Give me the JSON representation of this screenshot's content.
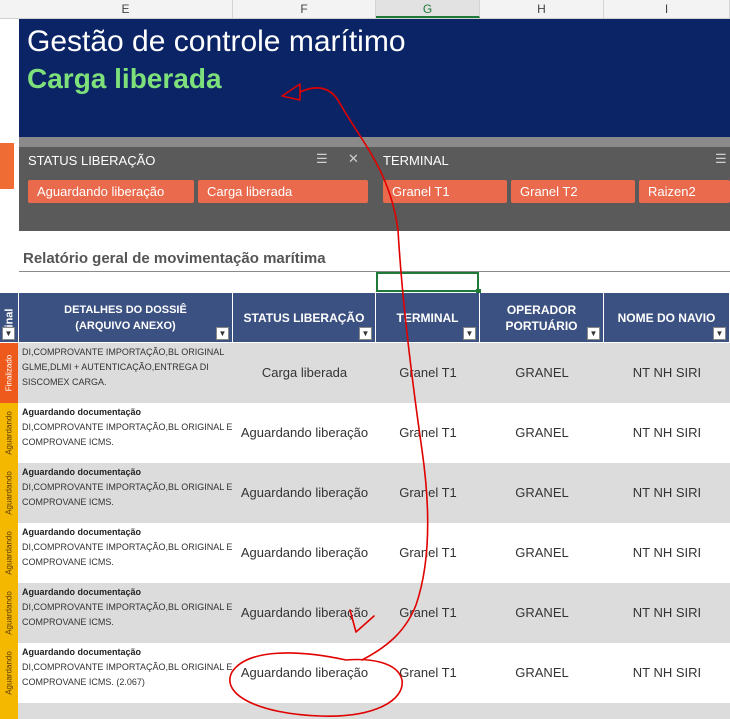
{
  "columns": [
    "E",
    "F",
    "G",
    "H",
    "I"
  ],
  "banner": {
    "title": "Gestão de controle marítimo",
    "subtitle": "Carga liberada"
  },
  "slicers": {
    "status": {
      "title": "STATUS LIBERAÇÃO",
      "items": [
        "Aguardando liberação",
        "Carga liberada"
      ]
    },
    "terminal": {
      "title": "TERMINAL",
      "items": [
        "Granel T1",
        "Granel T2",
        "Raizen2"
      ]
    }
  },
  "report_title": "Relatório geral de movimentação marítima",
  "table": {
    "headers": {
      "side": "inal",
      "details": "DETALHES DO DOSSIÊ (ARQUIVO ANEXO)",
      "status": "STATUS LIBERAÇÃO",
      "terminal": "TERMINAL",
      "operator": "OPERADOR PORTUÁRIO",
      "ship": "NOME DO NAVIO"
    },
    "rows": [
      {
        "tag": "Finalizado",
        "details_title": "",
        "details": "DI,COMPROVANTE IMPORTAÇÃO,BL ORIGINAL GLME,DLMI + AUTENTICAÇÃO,ENTREGA DI SISCOMEX CARGA.",
        "status": "Carga liberada",
        "terminal": "Granel T1",
        "operator": "GRANEL",
        "ship": "NT NH SIRI"
      },
      {
        "tag": "Aguardando",
        "details_title": "Aguardando documentação",
        "details": "DI,COMPROVANTE IMPORTAÇÃO,BL ORIGINAL E COMPROVANE ICMS.",
        "status": "Aguardando liberação",
        "terminal": "Granel T1",
        "operator": "GRANEL",
        "ship": "NT NH SIRI"
      },
      {
        "tag": "Aguardando",
        "details_title": "Aguardando documentação",
        "details": "DI,COMPROVANTE IMPORTAÇÃO,BL ORIGINAL E COMPROVANE ICMS.",
        "status": "Aguardando liberação",
        "terminal": "Granel T1",
        "operator": "GRANEL",
        "ship": "NT NH SIRI"
      },
      {
        "tag": "Aguardando",
        "details_title": "Aguardando documentação",
        "details": "DI,COMPROVANTE IMPORTAÇÃO,BL ORIGINAL E COMPROVANE ICMS.",
        "status": "Aguardando liberação",
        "terminal": "Granel T1",
        "operator": "GRANEL",
        "ship": "NT NH SIRI"
      },
      {
        "tag": "Aguardando",
        "details_title": "Aguardando documentação",
        "details": "DI,COMPROVANTE IMPORTAÇÃO,BL ORIGINAL E COMPROVANE ICMS.",
        "status": "Aguardando liberação",
        "terminal": "Granel T1",
        "operator": "GRANEL",
        "ship": "NT NH SIRI"
      },
      {
        "tag": "Aguardando",
        "details_title": "Aguardando documentação",
        "details": "DI,COMPROVANTE IMPORTAÇÃO,BL ORIGINAL E COMPROVANE ICMS. (2.067)",
        "status": "Aguardando liberação",
        "terminal": "Granel T1",
        "operator": "GRANEL",
        "ship": "NT NH SIRI"
      }
    ]
  },
  "colors": {
    "banner": "#0b2466",
    "accent_green": "#7de07a",
    "chip": "#ea6a4e",
    "table_header": "#3b5181",
    "finalizado": "#ee5a1b",
    "aguardando": "#f5b800",
    "annotation": "#e00000"
  },
  "icons": [
    "multi-select-icon",
    "clear-filter-icon",
    "filter-dropdown-icon"
  ]
}
